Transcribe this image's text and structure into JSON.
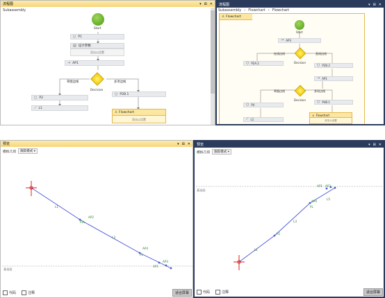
{
  "flow_left": {
    "title": "流程图",
    "breadcrumb": "Subassembly",
    "start_label": "Start",
    "nodes": {
      "p1": "P1",
      "add_var": "设计参数",
      "add_placeholder": "双击以设置",
      "ap1": "AP1",
      "decision": "Decision",
      "branch_left": "草图边线",
      "branch_right": "多项边线",
      "p2": "P2",
      "l1": "L1",
      "p2b": "P2B.1",
      "flowchart": "Flowchart",
      "flowchart_body": "双击以设置"
    }
  },
  "flow_right": {
    "title": "流程图",
    "breadcrumbs": [
      "Subassembly",
      "Flowchart",
      "Flowchart"
    ],
    "header_tab": "Flowchart",
    "start_label": "Start",
    "nodes": {
      "ap3": "AP3",
      "decision1": "Decision",
      "b1_left": "在线边线",
      "b1_right": "直线边线",
      "p2a2": "P2A.2",
      "p2b2": "P2B.2",
      "ap1": "AP1",
      "b2_left": "草图边线",
      "b2_right": "多项边线",
      "decision2": "Decision",
      "p4": "P4",
      "p4b1": "P4B.1",
      "l1": "L1",
      "flowchart": "Flowchart",
      "flowchart_body": "双击以设置"
    }
  },
  "preview_left": {
    "title": "预览",
    "toolbar_label": "模拟几何",
    "mode_select": "跟踪模式",
    "ref_plane": "基准面",
    "checkbox_code": "代码",
    "checkbox_note": "注释",
    "fit_button": "适合屏幕",
    "labels": {
      "l1": "L1",
      "l3": "L3",
      "ap2": "AP2",
      "p2": "P2L",
      "ap4": "AP4",
      "pl": "PL",
      "ap1": "AP1",
      "ap3": "AP3"
    }
  },
  "preview_right": {
    "title": "预览",
    "toolbar_label": "模拟几何",
    "mode_select": "跟踪模式",
    "ref_plane": "基准面",
    "checkbox_code": "代码",
    "checkbox_note": "注释",
    "fit_button": "适合屏幕",
    "labels": {
      "l1": "L1",
      "l3": "L3",
      "l5": "L5",
      "ap1": "AP1",
      "ap3": "AP3",
      "ap4": "AP4",
      "p2": "P2",
      "pl": "PL"
    }
  },
  "colors": {
    "title_yellow": "#f7d67a",
    "title_blue": "#2b3b5c",
    "path_line": "#4a55d6",
    "marker_red": "#d42020",
    "label_green": "#2a8a2a"
  }
}
